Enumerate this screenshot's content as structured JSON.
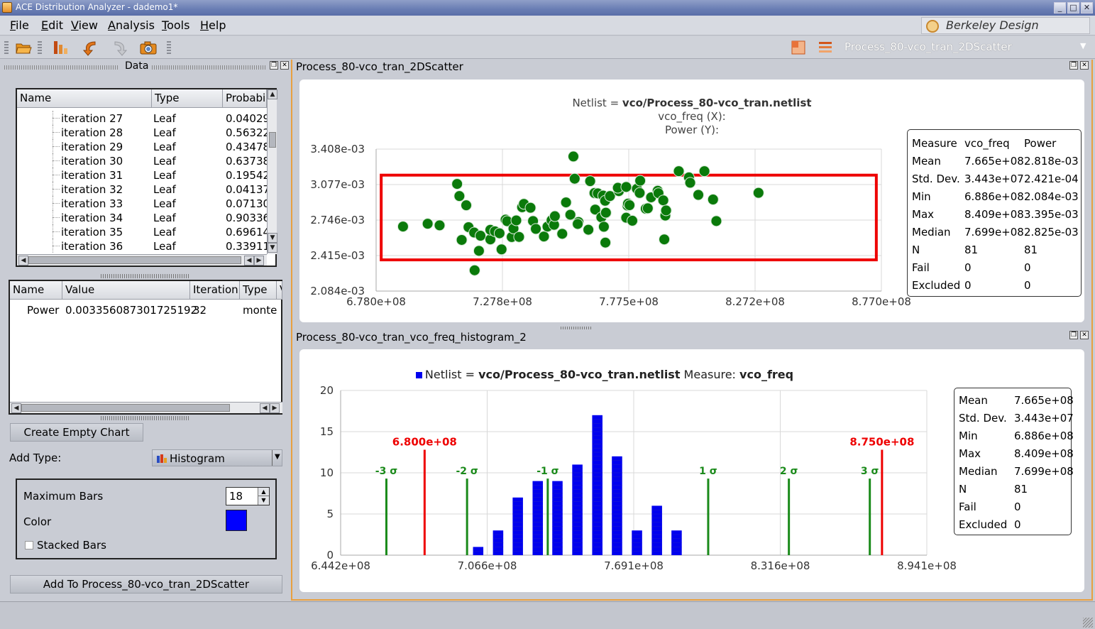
{
  "window": {
    "title": "ACE Distribution Analyzer - dademo1*"
  },
  "menu": {
    "items": [
      {
        "label": "File",
        "u": "F",
        "rest": "ile"
      },
      {
        "label": "Edit",
        "u": "E",
        "rest": "dit"
      },
      {
        "label": "View",
        "u": "V",
        "rest": "iew"
      },
      {
        "label": "Analysis",
        "u": "A",
        "rest": "nalysis"
      },
      {
        "label": "Tools",
        "u": "T",
        "rest": "ools"
      },
      {
        "label": "Help",
        "u": "H",
        "rest": "elp"
      }
    ],
    "brand": "Berkeley Design Automation"
  },
  "toolbar": {
    "selected_chart": "Process_80-vco_tran_2DScatter"
  },
  "data_panel": {
    "title": "Data",
    "tree_columns": [
      "Name",
      "Type",
      "Probabi"
    ],
    "tree_rows": [
      {
        "name": "iteration 27",
        "type": "Leaf",
        "prob": "0.04029"
      },
      {
        "name": "iteration 28",
        "type": "Leaf",
        "prob": "0.56322"
      },
      {
        "name": "iteration 29",
        "type": "Leaf",
        "prob": "0.43478"
      },
      {
        "name": "iteration 30",
        "type": "Leaf",
        "prob": "0.63738"
      },
      {
        "name": "iteration 31",
        "type": "Leaf",
        "prob": "0.19542"
      },
      {
        "name": "iteration 32",
        "type": "Leaf",
        "prob": "0.04137"
      },
      {
        "name": "iteration 33",
        "type": "Leaf",
        "prob": "0.07130"
      },
      {
        "name": "iteration 34",
        "type": "Leaf",
        "prob": "0.90336"
      },
      {
        "name": "iteration 35",
        "type": "Leaf",
        "prob": "0.69614"
      },
      {
        "name": "iteration 36",
        "type": "Leaf",
        "prob": "0.33911"
      }
    ],
    "detail_columns": [
      "Name",
      "Value",
      "Iteration",
      "Type",
      "V"
    ],
    "detail_rows": [
      {
        "name": "Power",
        "value": "0.003356087301725192",
        "iteration": "32",
        "type": "monte"
      }
    ],
    "create_empty_chart": "Create Empty Chart",
    "add_type_label": "Add Type:",
    "add_type_value": "Histogram",
    "max_bars_label": "Maximum Bars",
    "max_bars_value": "18",
    "color_label": "Color",
    "color_value": "#0000ff",
    "stacked_label": "Stacked Bars",
    "add_to_button": "Add To Process_80-vco_tran_2DScatter"
  },
  "scatter_pane": {
    "title": "Process_80-vco_tran_2DScatter",
    "header_lines": [
      {
        "plain": "Netlist = ",
        "bold": "vco/Process_80-vco_tran.netlist"
      },
      {
        "plain": "vco_freq (X):",
        "bold": ""
      },
      {
        "plain": "Power (Y):",
        "bold": ""
      }
    ],
    "stats": {
      "headers": [
        "Measure",
        "vco_freq",
        "Power"
      ],
      "rows": [
        [
          "Mean",
          "7.665e+08",
          "2.818e-03"
        ],
        [
          "Std. Dev.",
          "3.443e+07",
          "2.421e-04"
        ],
        [
          "Min",
          "6.886e+08",
          "2.084e-03"
        ],
        [
          "Max",
          "8.409e+08",
          "3.395e-03"
        ],
        [
          "Median",
          "7.699e+08",
          "2.825e-03"
        ],
        [
          "N",
          "81",
          "81"
        ],
        [
          "Fail",
          "0",
          "0"
        ],
        [
          "Excluded",
          "0",
          "0"
        ]
      ]
    }
  },
  "histogram_pane": {
    "title": "Process_80-vco_tran_vco_freq_histogram_2",
    "legend": {
      "plain1": "Netlist = ",
      "bold1": "vco/Process_80-vco_tran.netlist",
      "plain2": " Measure: ",
      "bold2": "vco_freq"
    },
    "stats": {
      "rows": [
        [
          "Mean",
          "7.665e+08"
        ],
        [
          "Std. Dev.",
          "3.443e+07"
        ],
        [
          "Min",
          "6.886e+08"
        ],
        [
          "Max",
          "8.409e+08"
        ],
        [
          "Median",
          "7.699e+08"
        ],
        [
          "N",
          "81"
        ],
        [
          "Fail",
          "0"
        ],
        [
          "Excluded",
          "0"
        ]
      ]
    }
  },
  "colors": {
    "accent_orange": "#e8a040",
    "scatter_point": "#0a7a0a",
    "spec_box": "#ee0000",
    "bar": "#0000ee",
    "sigma_line": "#1a8a1a",
    "limit_line": "#ee0000"
  },
  "chart_data": [
    {
      "type": "scatter",
      "xlabel": "vco_freq",
      "ylabel": "Power",
      "xlim": [
        678000000,
        877000000
      ],
      "ylim": [
        0.002084,
        0.003408
      ],
      "x_ticks": [
        "6.780e+08",
        "7.278e+08",
        "7.775e+08",
        "8.272e+08",
        "8.770e+08"
      ],
      "y_ticks": [
        "3.408e-03",
        "3.077e-03",
        "2.746e-03",
        "2.415e-03",
        "2.084e-03"
      ],
      "grid": true,
      "spec_box": {
        "x": [
          680000000,
          875000000
        ],
        "y": [
          0.002375,
          0.003165
        ]
      },
      "x": [
        688.6,
        698.3,
        703.0,
        709.9,
        710.8,
        713.5,
        714.4,
        711.7,
        716.6,
        718.5,
        719.1,
        716.8,
        723.0,
        723.0,
        724.8,
        726.6,
        727.4,
        729.0,
        729.6,
        731.4,
        732.1,
        733.2,
        734.3,
        735.5,
        736.2,
        738.8,
        739.8,
        740.9,
        744.1,
        745.5,
        747.1,
        748.1,
        748.4,
        751.3,
        752.8,
        754.5,
        755.7,
        756.2,
        757.7,
        757.4,
        761.6,
        762.3,
        764.3,
        764.0,
        765.3,
        766.7,
        767.4,
        767.7,
        768.3,
        768.5,
        768.5,
        768.2,
        770.1,
        773.6,
        773.2,
        776.5,
        776.5,
        777.0,
        777.2,
        777.8,
        778.9,
        780.7,
        781.8,
        782.0,
        784.2,
        785.0,
        786.3,
        788.9,
        789.2,
        791.1,
        791.9,
        792.2,
        791.5,
        797.2,
        801.2,
        801.7,
        804.9,
        807.3,
        810.7,
        812.0,
        828.6
      ],
      "y": [
        2.686,
        2.712,
        2.697,
        3.083,
        2.97,
        2.884,
        2.68,
        2.561,
        2.63,
        2.459,
        2.6,
        2.278,
        2.566,
        2.655,
        2.641,
        2.623,
        2.473,
        2.75,
        2.736,
        2.588,
        2.667,
        2.743,
        2.589,
        2.866,
        2.897,
        2.861,
        2.737,
        2.664,
        2.593,
        2.685,
        2.744,
        2.702,
        2.782,
        2.618,
        2.911,
        2.796,
        3.339,
        3.132,
        2.728,
        2.71,
        2.656,
        3.109,
        2.844,
        2.998,
        2.995,
        2.772,
        2.974,
        2.684,
        2.536,
        2.812,
        2.815,
        2.926,
        2.97,
        3.016,
        3.047,
        3.055,
        2.768,
        2.881,
        2.899,
        2.885,
        2.74,
        3.038,
        2.999,
        3.113,
        2.852,
        2.856,
        2.958,
        3.019,
        2.997,
        2.93,
        2.788,
        2.836,
        2.566,
        3.202,
        3.144,
        3.094,
        2.981,
        3.202,
        2.938,
        2.737,
        3.0
      ],
      "y_scale": 0.001,
      "x_scale": 1000000
    },
    {
      "type": "bar",
      "title": "Netlist = vco/Process_80-vco_tran.netlist Measure: vco_freq",
      "xlim": [
        644200000,
        894100000
      ],
      "ylim": [
        0,
        20
      ],
      "x_ticks": [
        "6.442e+08",
        "7.066e+08",
        "7.691e+08",
        "8.316e+08",
        "8.941e+08"
      ],
      "y_ticks": [
        "20",
        "15",
        "10",
        "5",
        "0"
      ],
      "grid": true,
      "bin_centers": [
        693.1,
        701.6,
        710.1,
        718.5,
        727.0,
        735.4,
        743.9,
        752.4,
        760.8,
        769.3,
        777.7,
        786.2,
        794.7,
        803.1,
        811.6,
        820.0,
        828.5,
        837.0
      ],
      "values": [
        0,
        1,
        3,
        7,
        9,
        9,
        11,
        17,
        12,
        3,
        6,
        3,
        0,
        0,
        0,
        0,
        0,
        0
      ],
      "bin_width_mhz": 8.46,
      "values_in_plot": [
        1,
        3,
        7,
        9,
        9,
        11,
        17,
        12,
        3,
        6,
        3
      ],
      "bars_x_start_mhz": [
        698.6,
        707.1,
        715.5,
        724.0,
        732.4,
        740.9,
        749.4,
        757.8,
        766.3,
        774.8,
        783.2
      ],
      "limits": [
        {
          "label": "6.800e+08",
          "x": 680.0
        },
        {
          "label": "8.750e+08",
          "x": 875.0
        }
      ],
      "sigma_lines": [
        {
          "label": "-3 σ",
          "x": 663.7
        },
        {
          "label": "-2 σ",
          "x": 698.1
        },
        {
          "label": "-1 σ",
          "x": 732.5
        },
        {
          "label": "1 σ",
          "x": 800.9
        },
        {
          "label": "2 σ",
          "x": 835.3
        },
        {
          "label": "3 σ",
          "x": 869.8
        }
      ]
    }
  ]
}
